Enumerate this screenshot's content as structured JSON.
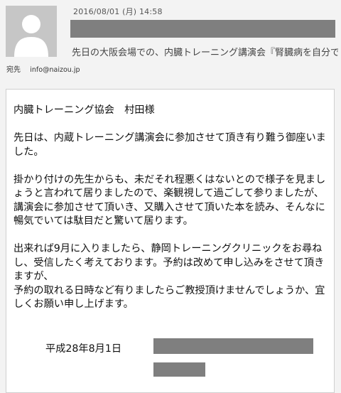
{
  "header": {
    "date": "2016/08/01 (月) 14:58",
    "subject": "先日の大阪会場での、内臓トレーニング講演会『腎臓病を自分で",
    "to_label": "宛先",
    "to_address": "info@naizou.jp"
  },
  "body": {
    "greeting": "内臓トレーニング協会　村田様",
    "para1": "先日は、内蔵トレーニング講演会に参加させて頂き有り難う御座いました。",
    "para2_line1": "掛かり付けの先生からも、未だそれ程悪くはないとので様子を見ましょうと言われて居りましたので、楽観視して過ごして参りましたが、",
    "para2_line2": "講演会に参加させて頂いき、又購入させて頂いた本を読み、そんなに暢気でいては駄目だと驚いて居ります。",
    "para3_line1": "出来れば9月に入りましたら、静岡トレーニングクリニックをお尋ねし、受信したく考えております。予約は改めて申し込みをさせて頂きますが、",
    "para3_line2": "予約の取れる日時など有りましたらご教授頂けませんでしょうか、宜しくお願い申し上げます。",
    "date_line": "平成28年8月1日"
  }
}
